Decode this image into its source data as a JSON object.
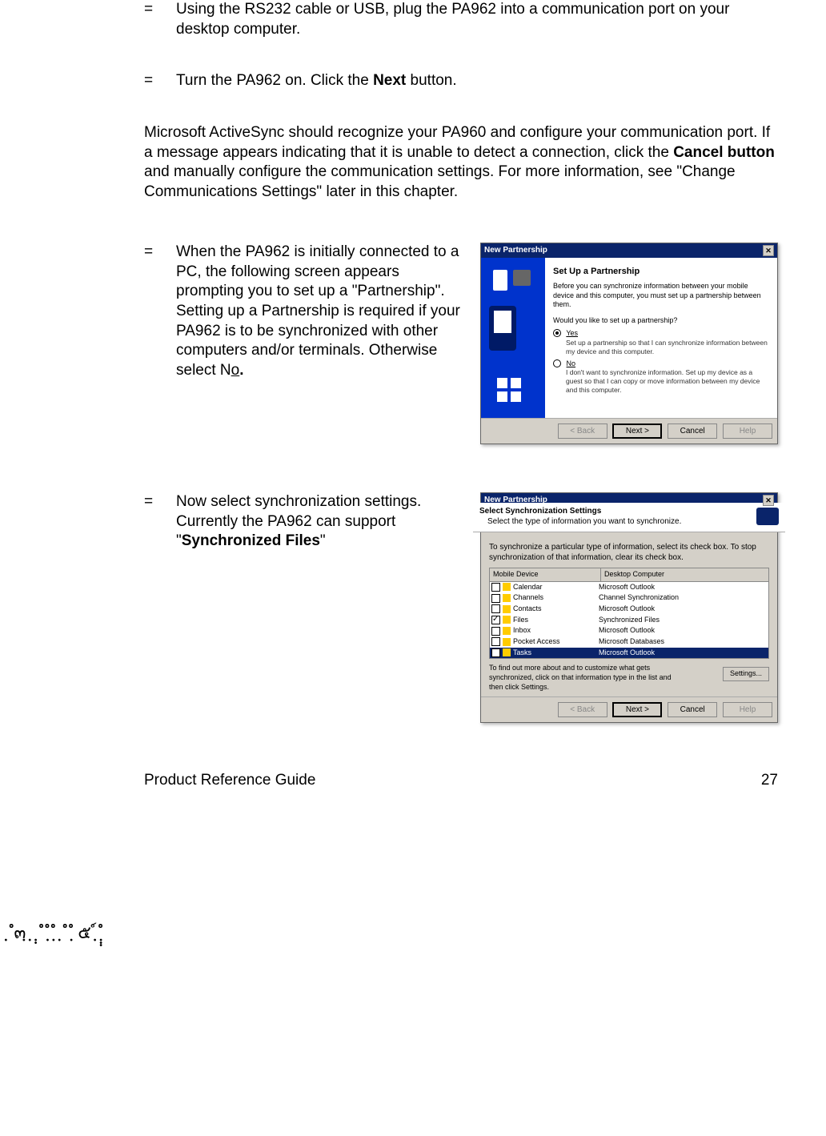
{
  "bullets": {
    "b1": "Using the RS232 cable or USB, plug the PA962 into a communication port on your desktop computer.",
    "b2_pre": "Turn the PA962 on.  Click the ",
    "b2_bold": "Next",
    "b2_post": " button.",
    "b3_pre": "When the PA962 is initially connected to a PC, the following screen appears prompting you to set up a \"Partnership\".  Setting up a Partnership is required if your PA962 is to be synchronized with other computers and/or terminals.  Otherwise select N",
    "b3_underline": "o",
    "b3_post": ".",
    "b4_pre": "Now select synchronization settings.  Currently the PA962 can support \"",
    "b4_bold": "Synchronized Files",
    "b4_post": "\""
  },
  "para": {
    "p1_pre": "Microsoft ActiveSync should recognize your PA960 and configure your communication port.  If a message appears indicating that it is unable to detect a connection, click the ",
    "p1_bold": "Cancel button",
    "p1_post": " and manually configure the communication settings.  For more information, see \"Change Communications Settings\" later in this chapter."
  },
  "dialog1": {
    "title": "New Partnership",
    "heading": "Set Up a Partnership",
    "intro": "Before you can synchronize information between your mobile device and this computer, you must set up a partnership between them.",
    "question": "Would you like to set up a partnership?",
    "yes_label": "Yes",
    "yes_sub": "Set up a partnership so that I can synchronize information between my device and this computer.",
    "no_label": "No",
    "no_sub": "I don't want to synchronize information. Set up my device as a guest so that I can copy or move information between my device and this computer.",
    "back": "< Back",
    "next": "Next >",
    "cancel": "Cancel",
    "help": "Help"
  },
  "dialog2": {
    "title": "New Partnership",
    "heading": "Select Synchronization Settings",
    "sub": "Select the type of information you want to synchronize.",
    "instr": "To synchronize a particular type of information, select its check box. To stop synchronization of that information, clear its check box.",
    "col1": "Mobile Device",
    "col2": "Desktop Computer",
    "rows": [
      {
        "name": "Calendar",
        "desk": "Microsoft Outlook",
        "checked": false
      },
      {
        "name": "Channels",
        "desk": "Channel Synchronization",
        "checked": false
      },
      {
        "name": "Contacts",
        "desk": "Microsoft Outlook",
        "checked": false
      },
      {
        "name": "Files",
        "desk": "Synchronized Files",
        "checked": true
      },
      {
        "name": "Inbox",
        "desk": "Microsoft Outlook",
        "checked": false
      },
      {
        "name": "Pocket Access",
        "desk": "Microsoft Databases",
        "checked": false
      },
      {
        "name": "Tasks",
        "desk": "Microsoft Outlook",
        "checked": false,
        "selected": true
      }
    ],
    "hint": "To find out more about and to customize what gets synchronized, click on that information type in the list and then click Settings.",
    "settings_btn": "Settings...",
    "back": "< Back",
    "next": "Next >",
    "cancel": "Cancel",
    "help": "Help"
  },
  "footer": {
    "left": "Product Reference Guide",
    "right": "27"
  },
  "garble": "ฺ ํ๓ฺ     ฺ ฺฺ ํ ํฺ ฺํ ฺ ํ ํฺ ๕   ฺ์       ํฺฺฺ"
}
